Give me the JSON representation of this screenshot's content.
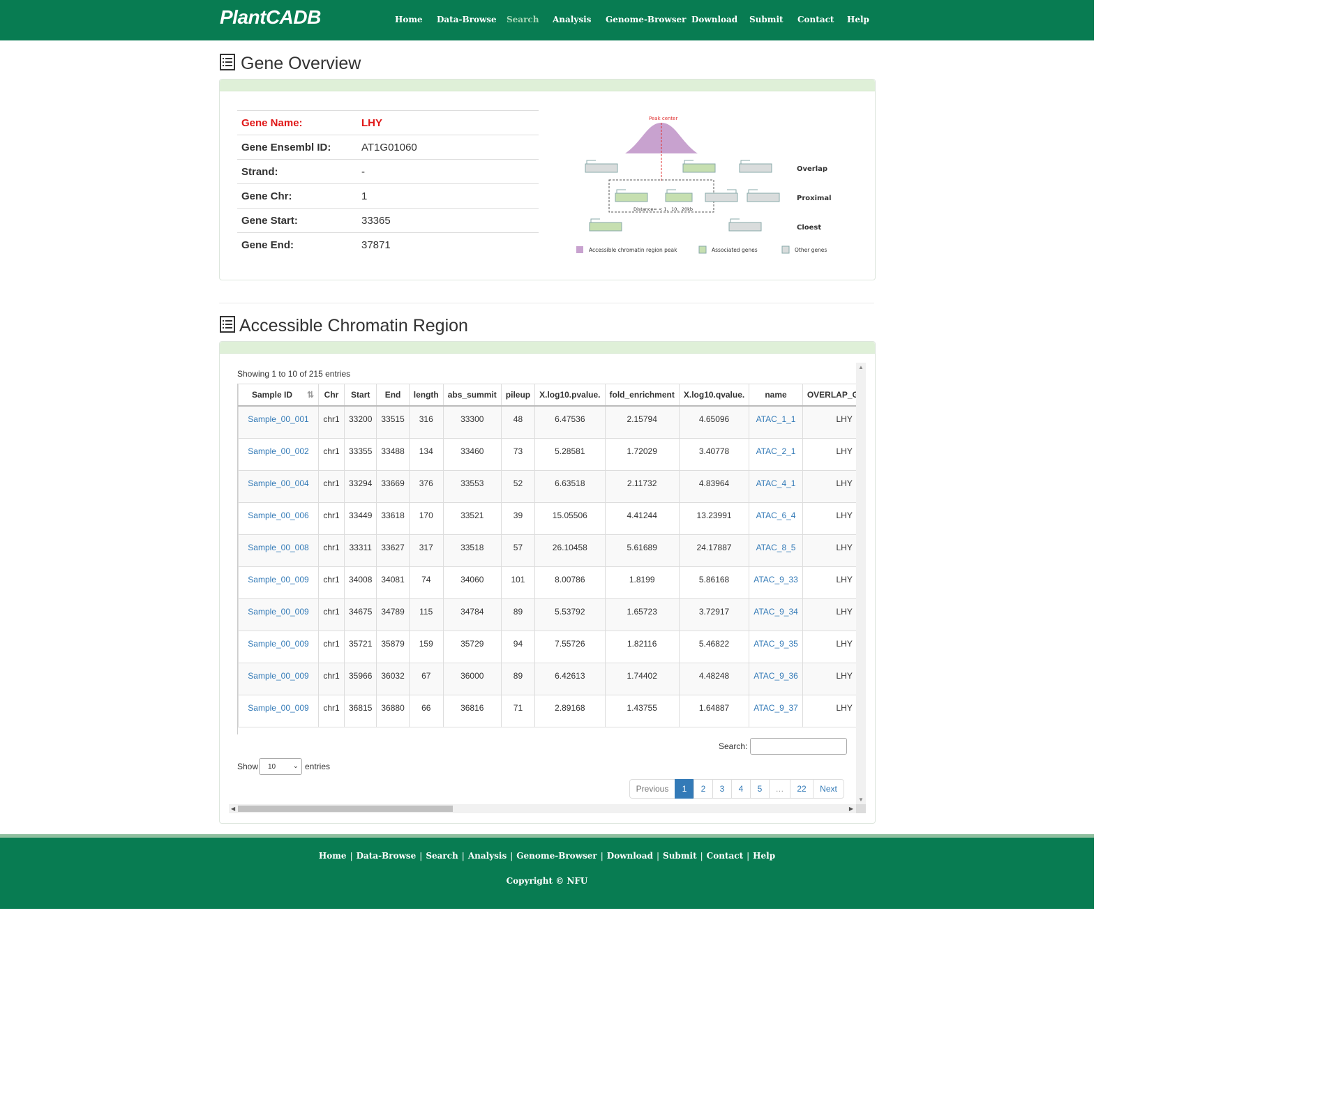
{
  "brand": "PlantCADB",
  "nav": [
    "Home",
    "Data-Browse",
    "Search",
    "Analysis",
    "Genome-Browser",
    "Download",
    "Submit",
    "Contact",
    "Help"
  ],
  "nav_active": "Search",
  "gene_overview": {
    "title": "Gene Overview",
    "rows": [
      {
        "label": "Gene Name:",
        "value": "LHY"
      },
      {
        "label": "Gene Ensembl ID:",
        "value": "AT1G01060"
      },
      {
        "label": "Strand:",
        "value": "-"
      },
      {
        "label": "Gene Chr:",
        "value": "1"
      },
      {
        "label": "Gene Start:",
        "value": "33365"
      },
      {
        "label": "Gene End:",
        "value": "37871"
      }
    ],
    "diagram": {
      "peak_label": "Peak center",
      "row_labels": [
        "Overlap",
        "Proximal",
        "Cloest"
      ],
      "distance_label": "Distance= < 1、10、20kb",
      "legend": [
        "Accessible chromatin region peak",
        "Associated genes",
        "Other genes"
      ],
      "colors": {
        "peak": "#c8a2cf",
        "associated": "#c6dfb0",
        "other": "#d9dcdc",
        "center_line": "#e03030"
      }
    }
  },
  "acr": {
    "title": "Accessible Chromatin Region",
    "showing": "Showing 1 to 10 of 215 entries",
    "columns": [
      "Sample ID",
      "Chr",
      "Start",
      "End",
      "length",
      "abs_summit",
      "pileup",
      "X.log10.pvalue.",
      "fold_enrichment",
      "X.log10.qvalue.",
      "name",
      "OVERLAP_GENES"
    ],
    "rows": [
      [
        "Sample_00_001",
        "chr1",
        "33200",
        "33515",
        "316",
        "33300",
        "48",
        "6.47536",
        "2.15794",
        "4.65096",
        "ATAC_1_1",
        "LHY"
      ],
      [
        "Sample_00_002",
        "chr1",
        "33355",
        "33488",
        "134",
        "33460",
        "73",
        "5.28581",
        "1.72029",
        "3.40778",
        "ATAC_2_1",
        "LHY"
      ],
      [
        "Sample_00_004",
        "chr1",
        "33294",
        "33669",
        "376",
        "33553",
        "52",
        "6.63518",
        "2.11732",
        "4.83964",
        "ATAC_4_1",
        "LHY"
      ],
      [
        "Sample_00_006",
        "chr1",
        "33449",
        "33618",
        "170",
        "33521",
        "39",
        "15.05506",
        "4.41244",
        "13.23991",
        "ATAC_6_4",
        "LHY"
      ],
      [
        "Sample_00_008",
        "chr1",
        "33311",
        "33627",
        "317",
        "33518",
        "57",
        "26.10458",
        "5.61689",
        "24.17887",
        "ATAC_8_5",
        "LHY"
      ],
      [
        "Sample_00_009",
        "chr1",
        "34008",
        "34081",
        "74",
        "34060",
        "101",
        "8.00786",
        "1.8199",
        "5.86168",
        "ATAC_9_33",
        "LHY"
      ],
      [
        "Sample_00_009",
        "chr1",
        "34675",
        "34789",
        "115",
        "34784",
        "89",
        "5.53792",
        "1.65723",
        "3.72917",
        "ATAC_9_34",
        "LHY"
      ],
      [
        "Sample_00_009",
        "chr1",
        "35721",
        "35879",
        "159",
        "35729",
        "94",
        "7.55726",
        "1.82116",
        "5.46822",
        "ATAC_9_35",
        "LHY"
      ],
      [
        "Sample_00_009",
        "chr1",
        "35966",
        "36032",
        "67",
        "36000",
        "89",
        "6.42613",
        "1.74402",
        "4.48248",
        "ATAC_9_36",
        "LHY"
      ],
      [
        "Sample_00_009",
        "chr1",
        "36815",
        "36880",
        "66",
        "36816",
        "71",
        "2.89168",
        "1.43755",
        "1.64887",
        "ATAC_9_37",
        "LHY"
      ]
    ],
    "search_label": "Search:",
    "search_value": "",
    "show_label": "Show",
    "page_size": "10",
    "entries_label": "entries",
    "pagination": [
      "Previous",
      "1",
      "2",
      "3",
      "4",
      "5",
      "…",
      "22",
      "Next"
    ],
    "current_page": "1"
  },
  "footer": {
    "links": [
      "Home",
      "Data-Browse",
      "Search",
      "Analysis",
      "Genome-Browser",
      "Download",
      "Submit",
      "Contact",
      "Help"
    ],
    "copyright": "Copyright © NFU"
  }
}
